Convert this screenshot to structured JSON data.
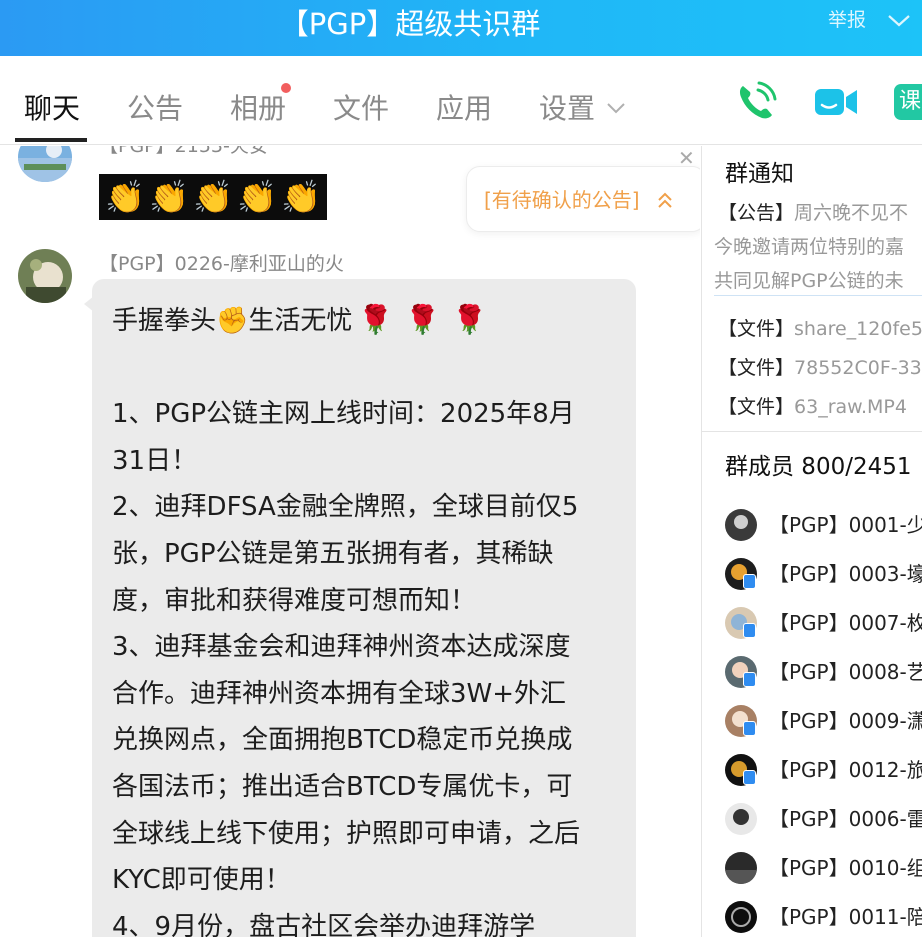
{
  "window": {
    "title": "【PGP】超级共识群",
    "report": "举报"
  },
  "tabs": [
    "聊天",
    "公告",
    "相册",
    "文件",
    "应用",
    "设置"
  ],
  "toolbar": {
    "extra_label": "课"
  },
  "chat": {
    "prev_sender": "【PGP】2153-火安",
    "pending_notice": "[有待确认的公告]",
    "sender": "【PGP】0226-摩利亚山的火",
    "lines": [
      "手握拳头✊生活无忧",
      "",
      "1、PGP公链主网上线时间：2025年8月",
      "31日！",
      "2、迪拜DFSA金融全牌照，全球目前仅5",
      "张，PGP公链是第五张拥有者，其稀缺",
      "度，审批和获得难度可想而知！",
      "3、迪拜基金会和迪拜神州资本达成深度",
      "合作。迪拜神州资本拥有全球3W+外汇",
      "兑换网点，全面拥抱BTCD稳定币兑换成",
      "各国法币；推出适合BTCD专属优卡，可",
      "全球线上线下使用；护照即可申请，之后",
      "KYC即可使用！",
      "4、9月份，盘古社区会举办迪拜游学"
    ]
  },
  "side": {
    "notice_title": "群通知",
    "notice_tag": "【公告】",
    "notice_lines": [
      "周六晚不见不",
      "今晚邀请两位特别的嘉",
      "共同见解PGP公链的未"
    ],
    "files": [
      {
        "tag": "【文件】",
        "name": "share_120fe5"
      },
      {
        "tag": "【文件】",
        "name": "78552C0F-33"
      },
      {
        "tag": "【文件】",
        "name": "63_raw.MP4"
      }
    ],
    "members_title": "群成员 800/2451",
    "members": [
      "【PGP】0001-少",
      "【PGP】0003-壕",
      "【PGP】0007-枚",
      "【PGP】0008-艺",
      "【PGP】0009-潇",
      "【PGP】0012-旅",
      "【PGP】0006-雷",
      "【PGP】0010-组",
      "【PGP】0011-陪"
    ]
  },
  "colors": {
    "title_bar": "#20b6f7",
    "accent_green": "#1fc46c",
    "accent_cyan": "#1cc2e8",
    "notice_orange": "#f0a04a"
  }
}
